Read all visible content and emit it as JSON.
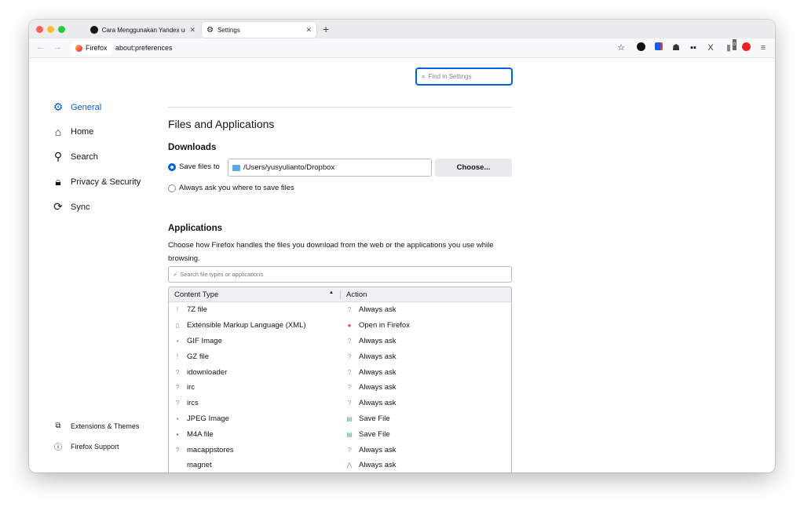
{
  "tabs": [
    {
      "title": "Cara Menggunakan Yandex untu",
      "icon": "site-icon"
    },
    {
      "title": "Settings",
      "icon": "gear-icon"
    }
  ],
  "new_tab": "+",
  "urlbar": {
    "identity": "Firefox",
    "url": "about:preferences"
  },
  "toolbar_icons": [
    "bookmark-star-icon",
    "extension-eyes-icon",
    "extension-bitwarden-icon",
    "extension-ghost-icon",
    "extension-grid-icon",
    "extension-x-icon",
    "extension-badge-icon",
    "extension-red-icon",
    "menu-icon"
  ],
  "toolbar_badge": "0",
  "search": {
    "placeholder": "Find in Settings"
  },
  "sidebar": {
    "items": [
      {
        "label": "General",
        "icon": "gear-icon",
        "active": true
      },
      {
        "label": "Home",
        "icon": "home-icon"
      },
      {
        "label": "Search",
        "icon": "search-icon"
      },
      {
        "label": "Privacy & Security",
        "icon": "lock-icon"
      },
      {
        "label": "Sync",
        "icon": "sync-icon"
      }
    ],
    "footer": [
      {
        "label": "Extensions & Themes",
        "icon": "puzzle-icon"
      },
      {
        "label": "Firefox Support",
        "icon": "help-icon"
      }
    ]
  },
  "main": {
    "section_title": "Files and Applications",
    "downloads": {
      "title": "Downloads",
      "save_label": "Save files to",
      "path": "/Users/yusyulianto/Dropbox",
      "choose": "Choose...",
      "ask_label": "Always ask you where to save files"
    },
    "applications": {
      "title": "Applications",
      "description": "Choose how Firefox handles the files you download from the web or the applications you use while browsing.",
      "filter_placeholder": "Search file types or applications",
      "columns": [
        "Content Type",
        "Action"
      ],
      "rows": [
        {
          "type": "7Z file",
          "action": "Always ask"
        },
        {
          "type": "Extensible Markup Language (XML)",
          "action": "Open in Firefox"
        },
        {
          "type": "GIF Image",
          "action": "Always ask"
        },
        {
          "type": "GZ file",
          "action": "Always ask"
        },
        {
          "type": "idownloader",
          "action": "Always ask"
        },
        {
          "type": "irc",
          "action": "Always ask"
        },
        {
          "type": "ircs",
          "action": "Always ask"
        },
        {
          "type": "JPEG Image",
          "action": "Save File"
        },
        {
          "type": "M4A file",
          "action": "Save File"
        },
        {
          "type": "macappstores",
          "action": "Always ask"
        },
        {
          "type": "magnet",
          "action": "Always ask"
        }
      ]
    }
  },
  "colors": {
    "accent": "#0061e0"
  }
}
